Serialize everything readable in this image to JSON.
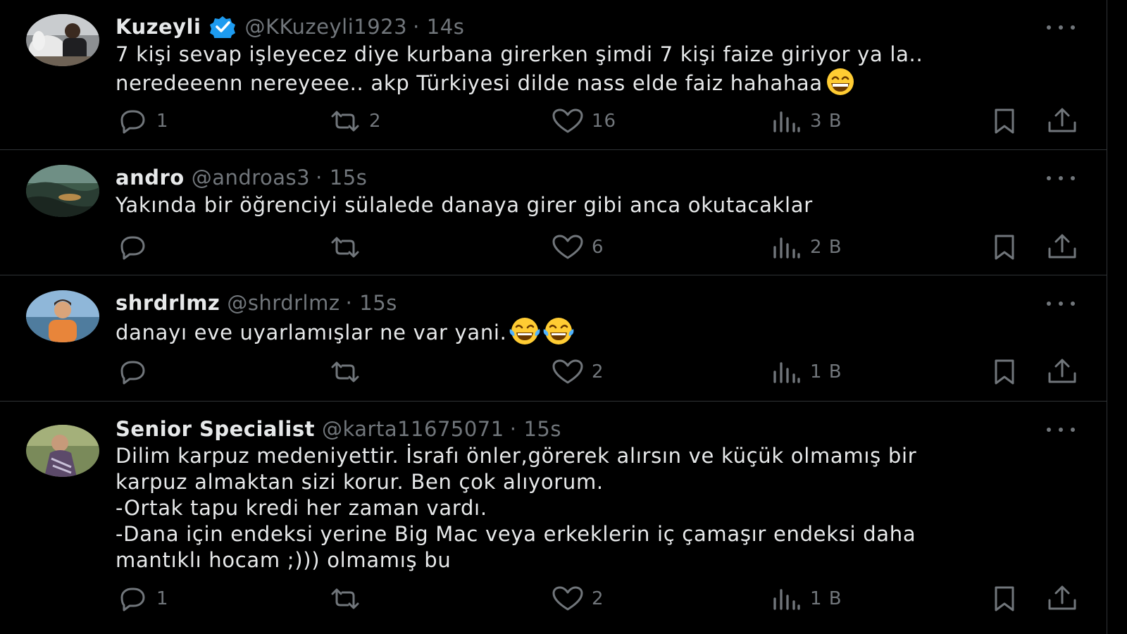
{
  "tweets": [
    {
      "display_name": "Kuzeyli",
      "verified": true,
      "handle": "@KKuzeyli1923",
      "time": "14s",
      "text_lines": [
        "7 kişi sevap işleyecez diye kurbana girerken şimdi 7 kişi faize giriyor ya la..",
        "neredeeenn nereyeee.. akp Türkiyesi dilde nass elde faiz hahahaa"
      ],
      "emojis": [
        "grinning-face-with-smiling-eyes"
      ],
      "replies": "1",
      "retweets": "2",
      "likes": "16",
      "views": "3 B"
    },
    {
      "display_name": "andro",
      "verified": false,
      "handle": "@androas3",
      "time": "15s",
      "text_lines": [
        "Yakında bir öğrenciyi sülalede danaya girer gibi anca okutacaklar"
      ],
      "emojis": [],
      "replies": "",
      "retweets": "",
      "likes": "6",
      "views": "2 B"
    },
    {
      "display_name": "shrdrlmz",
      "verified": false,
      "handle": "@shrdrlmz",
      "time": "15s",
      "text_lines": [
        "danayı eve uyarlamışlar ne var yani."
      ],
      "emojis": [
        "face-with-tears-of-joy",
        "face-with-tears-of-joy"
      ],
      "replies": "",
      "retweets": "",
      "likes": "2",
      "views": "1 B"
    },
    {
      "display_name": "Senior Specialist",
      "verified": false,
      "handle": "@karta11675071",
      "time": "15s",
      "text_lines": [
        "Dilim karpuz medeniyettir. İsrafı önler,görerek alırsın ve küçük olmamış bir",
        "karpuz almaktan sizi korur. Ben çok alıyorum.",
        "-Ortak tapu kredi her zaman vardı.",
        "-Dana için endeksi yerine Big Mac veya erkeklerin iç çamaşır endeksi daha",
        "mantıklı hocam ;))) olmamış bu"
      ],
      "emojis": [],
      "replies": "1",
      "retweets": "",
      "likes": "2",
      "views": "1 B"
    }
  ],
  "colors": {
    "background": "#000000",
    "primary_text": "#e7e9ea",
    "secondary_text": "#71767b",
    "divider": "#2f3336",
    "verified_blue": "#1d9bf0"
  }
}
